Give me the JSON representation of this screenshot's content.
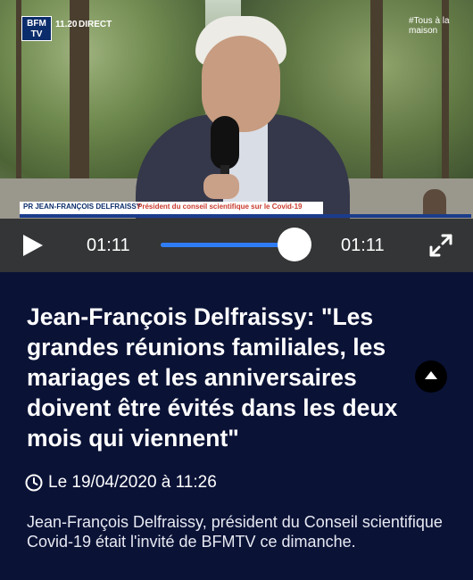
{
  "video": {
    "channel_logo": "BFM TV",
    "live_time": "11.20",
    "live_label": "DIRECT",
    "hashtag": "#Tous à la maison",
    "lower_third_name": "PR JEAN-FRANÇOIS DELFRAISSY",
    "lower_third_role": "Président du conseil scientifique sur le Covid-19"
  },
  "player": {
    "current_time": "01:11",
    "duration": "01:11",
    "progress": 1.0,
    "accent_color": "#2f7df6",
    "play_icon": "play-icon",
    "fullscreen_icon": "expand-icon"
  },
  "article": {
    "headline": "Jean-François Delfraissy: \"Les grandes réunions familiales, les mariages et les anniversaires doivent être évités dans les deux mois qui viennent\"",
    "date": "Le 19/04/2020 à 11:26",
    "summary": "Jean-François Delfraissy, président du Conseil scientifique Covid-19 était l'invité de BFMTV ce dimanche.",
    "collapse_icon": "chevron-up-icon",
    "date_icon": "clock-icon"
  },
  "colors": {
    "background": "#0a1236",
    "controls_bg": "#303034"
  }
}
